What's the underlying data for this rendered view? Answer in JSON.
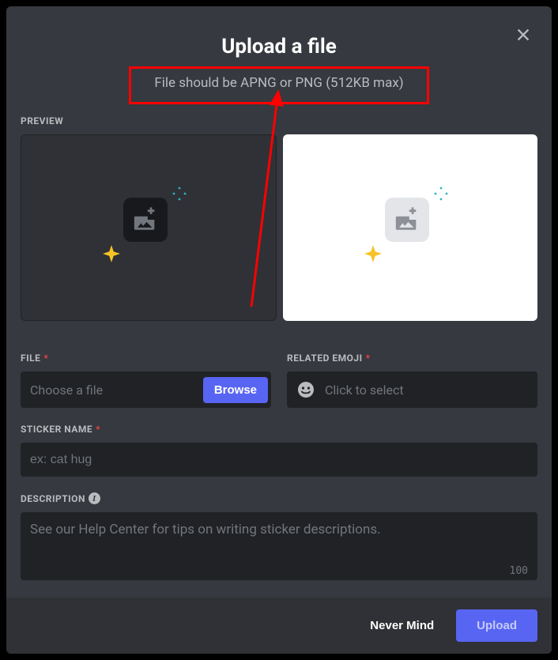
{
  "header": {
    "title": "Upload a file",
    "subtitle": "File should be APNG or PNG (512KB max)"
  },
  "labels": {
    "preview": "PREVIEW",
    "file": "FILE",
    "related_emoji": "RELATED EMOJI",
    "sticker_name": "STICKER NAME",
    "description": "DESCRIPTION"
  },
  "file_field": {
    "placeholder": "Choose a file",
    "browse_label": "Browse"
  },
  "emoji_field": {
    "placeholder": "Click to select"
  },
  "name_field": {
    "placeholder": "ex: cat hug"
  },
  "description_field": {
    "placeholder": "See our Help Center for tips on writing sticker descriptions.",
    "char_limit": "100"
  },
  "footer": {
    "cancel_label": "Never Mind",
    "submit_label": "Upload"
  },
  "icons": {
    "close": "close-icon",
    "image_placeholder": "image-add-icon",
    "sparkle": "sparkle-icon",
    "dots": "sparkle-dots-icon",
    "smiley": "smiley-icon",
    "info": "info-icon"
  }
}
